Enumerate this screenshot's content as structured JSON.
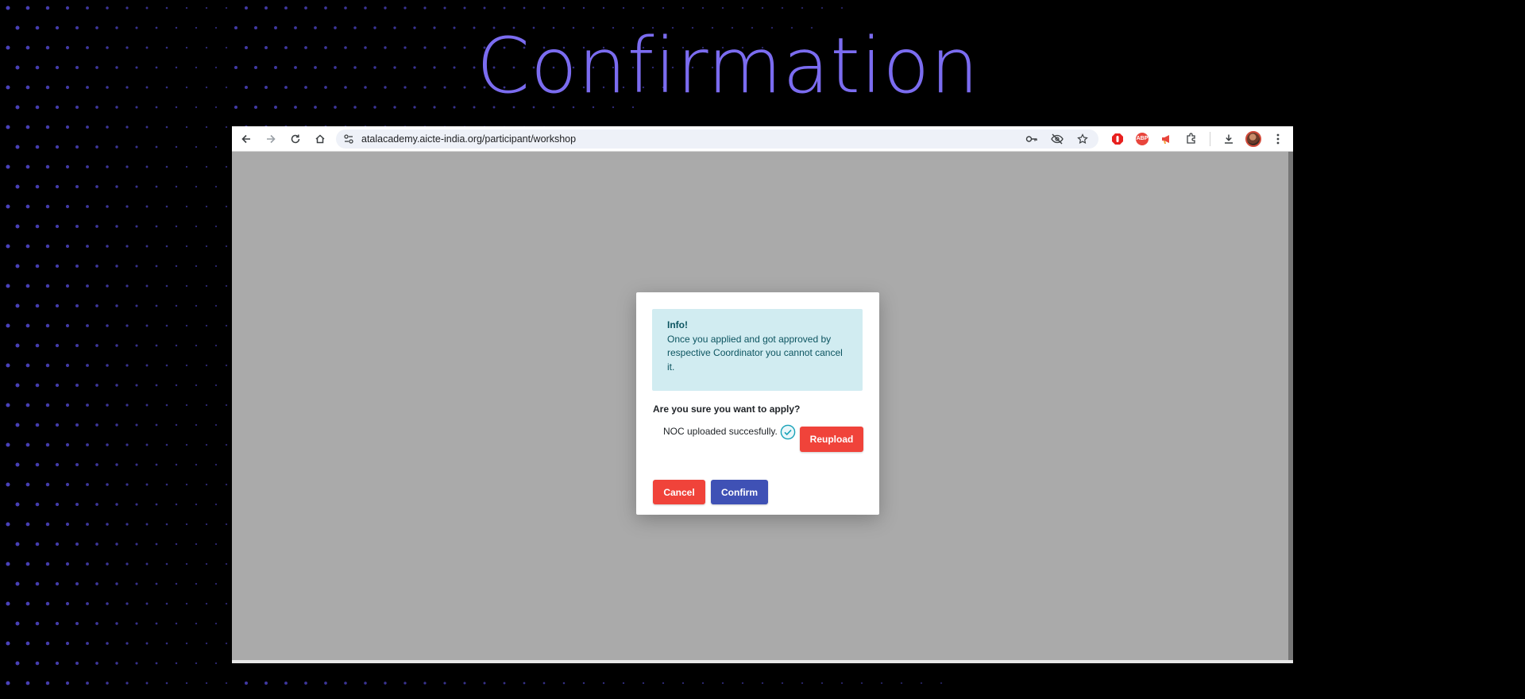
{
  "slide": {
    "title": "Confirmation",
    "accent_color": "#7b6cf0"
  },
  "browser": {
    "url": "atalacademy.aicte-india.org/participant/workshop",
    "nav_icons": [
      "back-icon",
      "forward-icon",
      "reload-icon",
      "home-icon"
    ],
    "omnibox_icons": [
      "site-settings-icon",
      "password-key-icon",
      "eye-off-icon",
      "star-icon"
    ],
    "extension_icons": [
      "adblock-icon",
      "adblock-plus-icon",
      "megaphone-icon",
      "puzzle-icon"
    ],
    "toolbar_icons": [
      "download-icon",
      "profile-avatar",
      "menu-dots-icon"
    ],
    "adblock_plus_label": "ABP"
  },
  "modal": {
    "alert": {
      "title": "Info!",
      "message": "Once you applied and got approved by respective Coordinator you cannot cancel it."
    },
    "question": "Are you sure you want to apply?",
    "noc_status": "NOC uploaded succesfully.",
    "buttons": {
      "reupload": "Reupload",
      "cancel": "Cancel",
      "confirm": "Confirm"
    },
    "colors": {
      "danger": "#f0433a",
      "primary": "#3f51b5",
      "info_bg": "#d1ecf1",
      "info_text": "#0c5460",
      "success": "#17a2b8"
    }
  }
}
